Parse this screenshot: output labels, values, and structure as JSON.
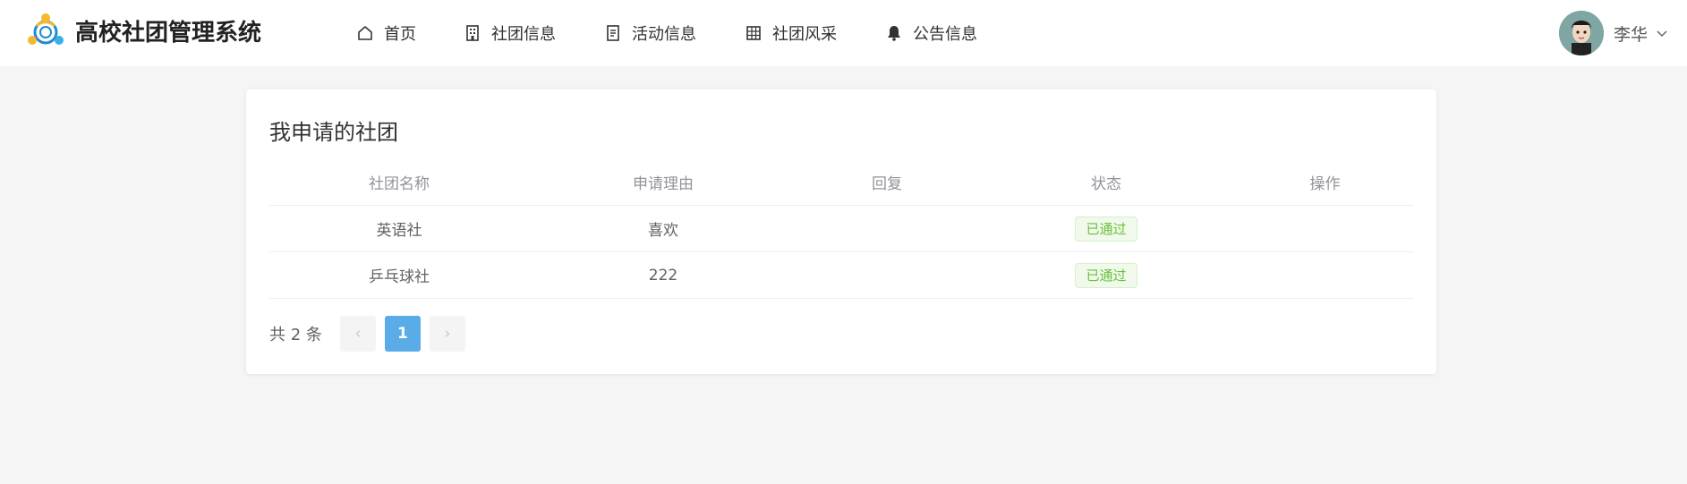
{
  "header": {
    "brand": "高校社团管理系统",
    "nav": [
      {
        "label": "首页",
        "icon": "home-icon"
      },
      {
        "label": "社团信息",
        "icon": "building-icon"
      },
      {
        "label": "活动信息",
        "icon": "document-icon"
      },
      {
        "label": "社团风采",
        "icon": "grid-icon"
      },
      {
        "label": "公告信息",
        "icon": "bell-icon"
      }
    ],
    "user": {
      "name": "李华"
    }
  },
  "main": {
    "title": "我申请的社团",
    "columns": [
      "社团名称",
      "申请理由",
      "回复",
      "状态",
      "操作"
    ],
    "rows": [
      {
        "name": "英语社",
        "reason": "喜欢",
        "reply": "",
        "status": "已通过",
        "action": ""
      },
      {
        "name": "乒乓球社",
        "reason": "222",
        "reply": "",
        "status": "已通过",
        "action": ""
      }
    ],
    "pagination": {
      "total": "共 2 条",
      "current": "1",
      "prev": "‹",
      "next": "›"
    }
  },
  "colors": {
    "accent": "#5aace8",
    "success": "#67c23a",
    "page_bg": "#f5f5f6"
  }
}
